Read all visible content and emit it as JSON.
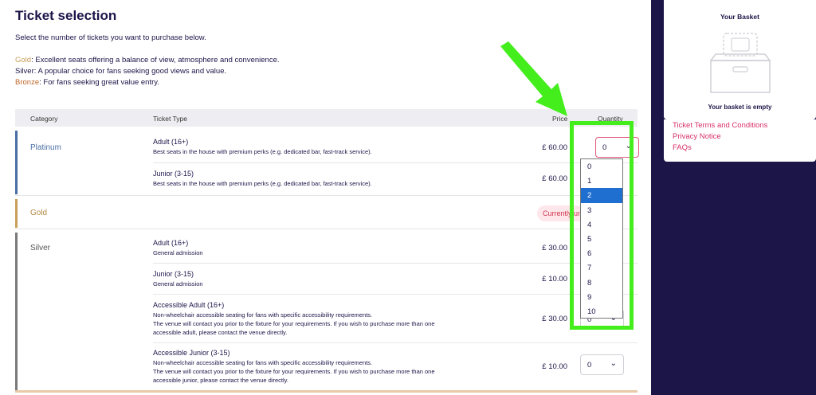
{
  "page": {
    "title": "Ticket selection",
    "intro": "Select the number of tickets you want to purchase below.",
    "tiers": [
      {
        "name": "Gold",
        "desc": " Excellent seats offering a balance of view, atmosphere and convenience."
      },
      {
        "name": "Silver",
        "desc": " A popular choice for fans seeking good views and value."
      },
      {
        "name": "Bronze",
        "desc": " For fans seeking great value entry."
      }
    ]
  },
  "table": {
    "headers": {
      "category": "Category",
      "ticket_type": "Ticket Type",
      "price": "Price",
      "quantity": "Quantity"
    },
    "categories": [
      {
        "name": "Platinum",
        "color": "#4a6fa5",
        "tickets": [
          {
            "name": "Adult (16+)",
            "desc": [
              "Best seats in the house with premium perks (e.g. dedicated bar, fast-track service)."
            ],
            "price": "£ 60.00",
            "qty": "0"
          },
          {
            "name": "Junior (3-15)",
            "desc": [
              "Best seats in the house with premium perks (e.g. dedicated bar, fast-track service)."
            ],
            "price": "£ 60.00",
            "qty": ""
          }
        ]
      },
      {
        "name": "Gold",
        "color": "#c9a05a",
        "badge": "Currently unavailable"
      },
      {
        "name": "Silver",
        "color": "#7a7a7a",
        "tickets": [
          {
            "name": "Adult (16+)",
            "desc": [
              "General admission"
            ],
            "price": "£ 30.00",
            "qty": ""
          },
          {
            "name": "Junior (3-15)",
            "desc": [
              "General admission"
            ],
            "price": "£ 10.00",
            "qty": ""
          },
          {
            "name": "Accessible Adult (16+)",
            "desc": [
              "Non-wheelchair accessible seating for fans with specific accessibility requirements.",
              "The venue will contact you prior to the fixture for your requirements. If you wish to purchase more than one",
              "accessible adult, please contact the venue directly."
            ],
            "price": "£ 30.00",
            "qty": "0"
          },
          {
            "name": "Accessible Junior (3-15)",
            "desc": [
              "Non-wheelchair accessible seating for fans with specific accessibility requirements.",
              "The venue will contact you prior to the fixture for your requirements. If you wish to purchase more than one",
              "accessible junior, please contact the venue directly."
            ],
            "price": "£ 10.00",
            "qty": "0"
          }
        ]
      }
    ]
  },
  "dropdown": {
    "options": [
      "0",
      "1",
      "2",
      "3",
      "4",
      "5",
      "6",
      "7",
      "8",
      "9",
      "10"
    ],
    "highlighted": "2",
    "chevron_icon": "chevron-down-icon"
  },
  "basket": {
    "title": "Your Basket",
    "empty_text": "Your basket is empty",
    "icon": "empty-basket-icon"
  },
  "links": [
    "Ticket Terms and Conditions",
    "Privacy Notice",
    "FAQs"
  ],
  "annotation": {
    "highlight_color": "#44ee1c"
  }
}
